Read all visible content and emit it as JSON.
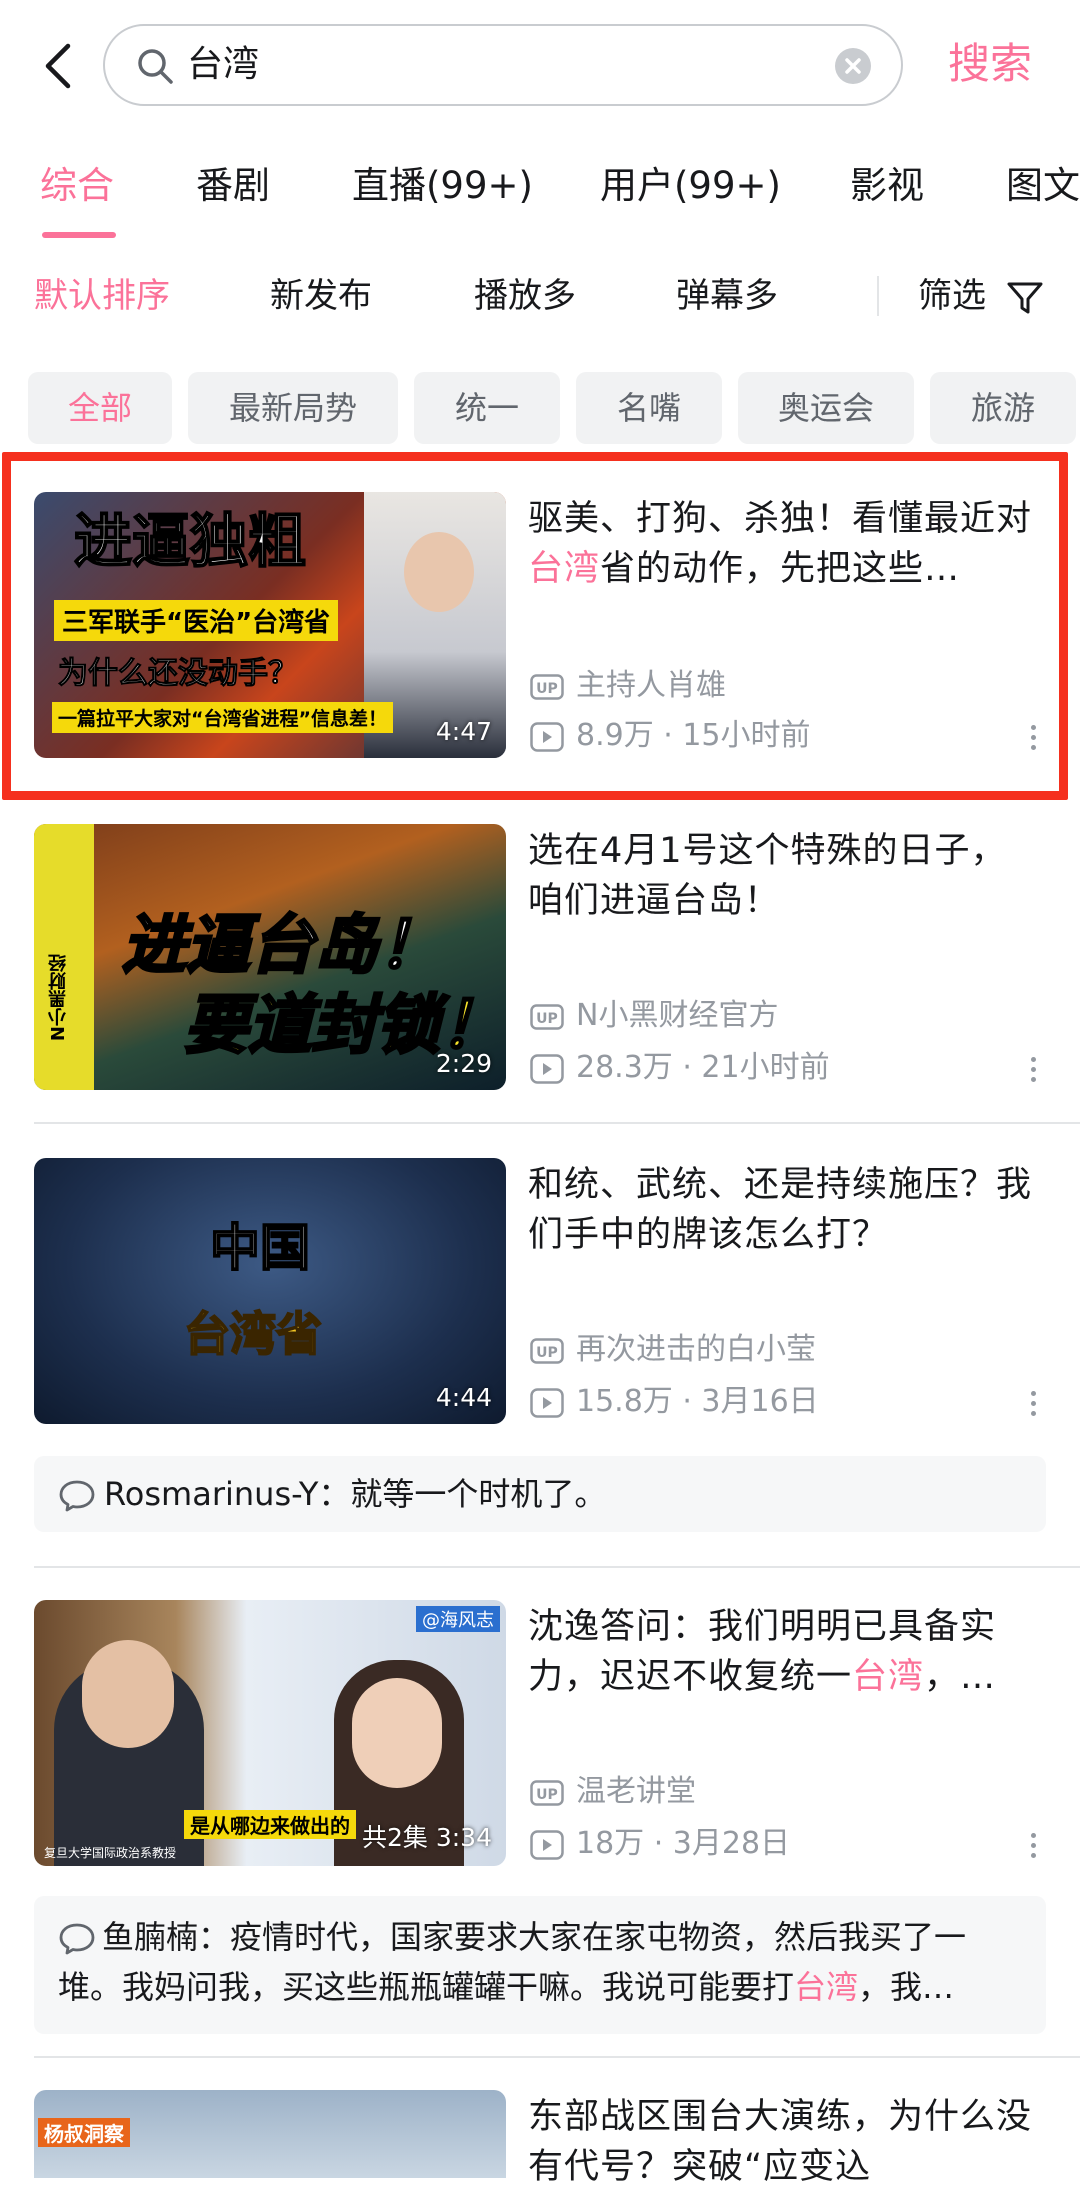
{
  "search": {
    "query": "台湾",
    "button_label": "搜索"
  },
  "tabs": [
    "综合",
    "番剧",
    "直播(99+)",
    "用户(99+)",
    "影视",
    "图文"
  ],
  "sort": [
    "默认排序",
    "新发布",
    "播放多",
    "弹幕多",
    "筛选"
  ],
  "chips": [
    "全部",
    "最新局势",
    "统一",
    "名嘴",
    "奥运会",
    "旅游"
  ],
  "colors": {
    "accent": "#fb7299",
    "highlight_border": "#f5301e",
    "meta": "#9499a0"
  },
  "videos": [
    {
      "title_before": "驱美、打狗、杀独！看懂最近对",
      "title_highlight": "台湾",
      "title_after": "省的动作，先把这些…",
      "uploader": "主持人肖雄",
      "views": "8.9万",
      "time": "15小时前",
      "duration": "4:47",
      "thumb_text": [
        "进逼独粗",
        "三军联手“医治”台湾省",
        "为什么还没动手？",
        "一篇拉平大家对“台湾省进程”信息差！"
      ]
    },
    {
      "title_before": "选在4月1号这个特殊的日子，咱们进逼台岛！",
      "title_highlight": "",
      "title_after": "",
      "uploader": "N小黑财经官方",
      "views": "28.3万",
      "time": "21小时前",
      "duration": "2:29",
      "thumb_text": [
        "进逼台岛！",
        "要道封锁！",
        "N小黑财经"
      ]
    },
    {
      "title_before": "和统、武统、还是持续施压？我们手中的牌该怎么打？",
      "title_highlight": "",
      "title_after": "",
      "uploader": "再次进击的白小莹",
      "views": "15.8万",
      "time": "3月16日",
      "duration": "4:44",
      "thumb_text": [
        "中国",
        "台湾省"
      ]
    },
    {
      "title_before": "沈逸答问：我们明明已具备实力，迟迟不收复统一",
      "title_highlight": "台湾",
      "title_after": "，…",
      "uploader": "温老讲堂",
      "views": "18万",
      "time": "3月28日",
      "duration": "共2集 3:34",
      "thumb_text": [
        "@海风志",
        "是从哪边来做出的",
        "复旦大学国际政治系教授"
      ]
    },
    {
      "title_before": "东部战区围台大演练，为什么没有代号？突破“应变込",
      "title_highlight": "",
      "title_after": "",
      "thumb_text": [
        "杨叔洞察"
      ]
    }
  ],
  "comments": [
    {
      "text": "Rosmarinus-Y：就等一个时机了。"
    },
    {
      "before": "鱼腩楠：疫情时代，国家要求大家在家屯物资，然后我买了一堆。我妈问我，买这些瓶瓶罐罐干嘛。我说可能要打",
      "highlight": "台湾",
      "after": "，我…"
    }
  ]
}
